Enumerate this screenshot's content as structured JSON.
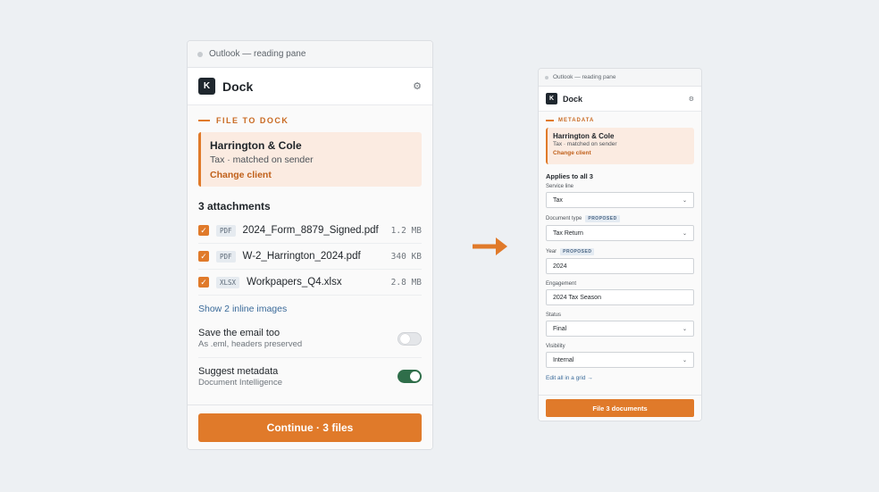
{
  "left": {
    "chrome_title": "Outlook — reading pane",
    "brand": {
      "logo_letter": "K",
      "name": "Dock"
    },
    "gear": "⚙",
    "section_label": "FILE TO DOCK",
    "client": {
      "name": "Harrington & Cole",
      "sub": "Tax · matched on sender",
      "link": "Change client"
    },
    "attachments_title": "3 attachments",
    "attachments": [
      {
        "type": "PDF",
        "name": "2024_Form_8879_Signed.pdf",
        "size": "1.2 MB",
        "checked": true
      },
      {
        "type": "PDF",
        "name": "W-2_Harrington_2024.pdf",
        "size": "340 KB",
        "checked": true
      },
      {
        "type": "XLSX",
        "name": "Workpapers_Q4.xlsx",
        "size": "2.8 MB",
        "checked": true
      }
    ],
    "show_inline": "Show 2 inline images",
    "toggles": [
      {
        "title": "Save the email too",
        "sub": "As .eml, headers preserved",
        "on": false
      },
      {
        "title": "Suggest metadata",
        "sub": "Document Intelligence",
        "on": true
      }
    ],
    "cta": "Continue · 3 files"
  },
  "right": {
    "chrome_title": "Outlook — reading pane",
    "brand": {
      "logo_letter": "K",
      "name": "Dock"
    },
    "gear": "⚙",
    "section_label": "METADATA",
    "client": {
      "name": "Harrington & Cole",
      "sub": "Tax · matched on sender",
      "link": "Change client"
    },
    "applies": "Applies to all 3",
    "fields": {
      "service_line": {
        "label": "Service line",
        "value": "Tax"
      },
      "document_type": {
        "label": "Document type",
        "badge": "PROPOSED",
        "value": "Tax Return"
      },
      "year": {
        "label": "Year",
        "badge": "PROPOSED",
        "value": "2024"
      },
      "engagement": {
        "label": "Engagement",
        "value": "2024 Tax Season"
      },
      "status": {
        "label": "Status",
        "value": "Final"
      },
      "visibility": {
        "label": "Visibility",
        "value": "Internal"
      }
    },
    "grid_link": "Edit all in a grid →",
    "cta": "File 3 documents"
  },
  "colors": {
    "accent": "#e07a2a",
    "toggle_on": "#2f6e4a",
    "link": "#3a6a99",
    "card_bg": "#fbebe1"
  },
  "icons": {
    "gear": "gear-icon",
    "check": "checkbox-checked-icon",
    "arrow": "arrow-right-icon",
    "chevron": "chevron-down-icon"
  }
}
